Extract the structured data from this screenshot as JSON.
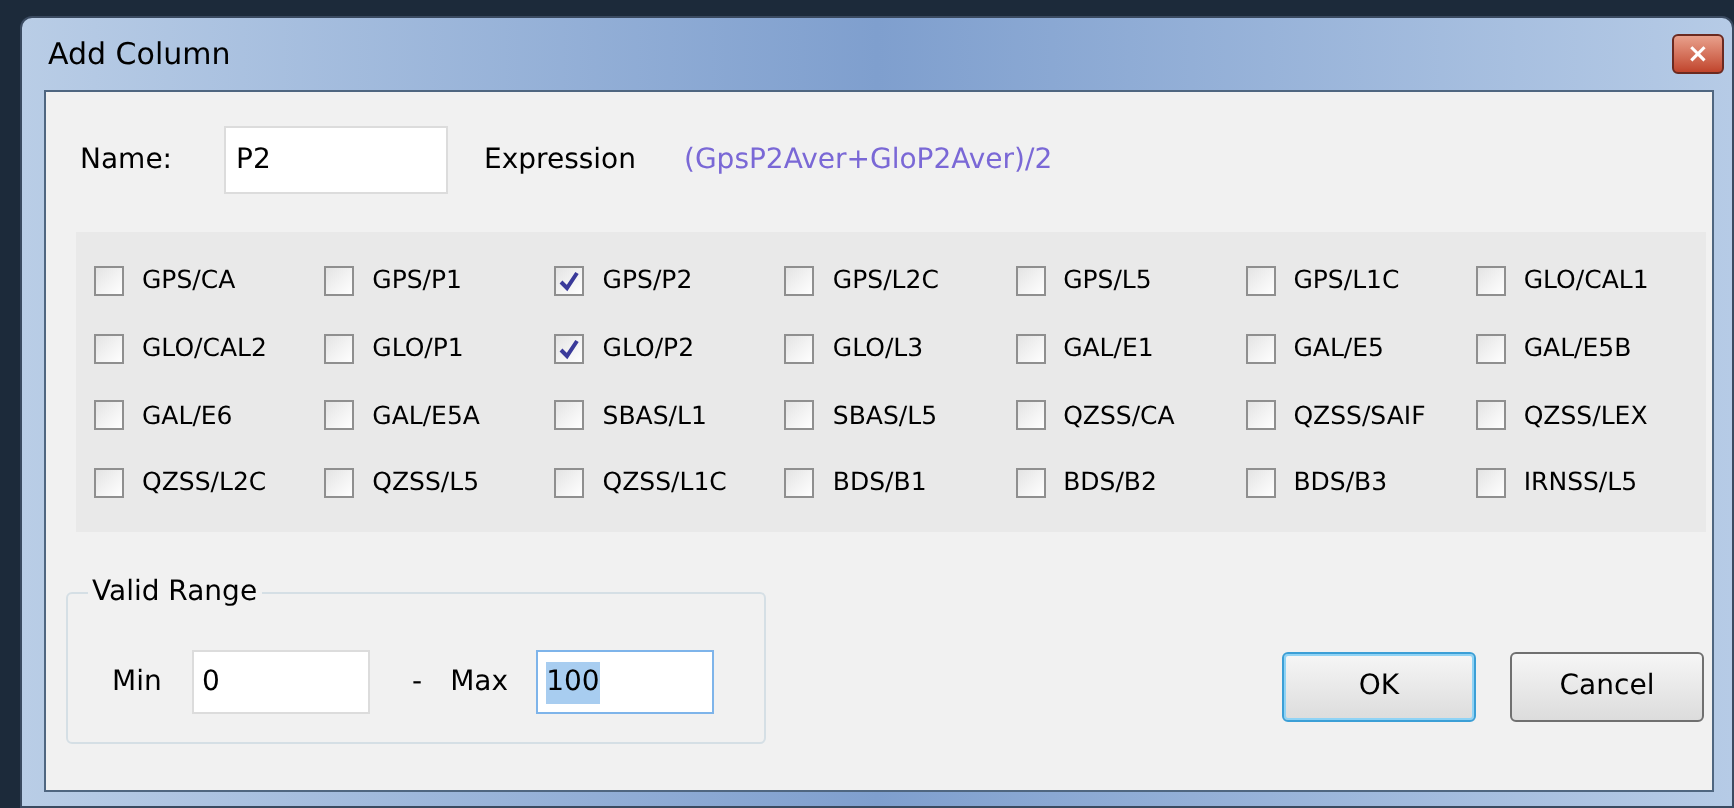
{
  "window": {
    "title": "Add Column",
    "close": "×"
  },
  "name_field": {
    "label": "Name:",
    "value": "P2"
  },
  "expression": {
    "label": "Expression",
    "value": "(GpsP2Aver+GloP2Aver)/2"
  },
  "signals": [
    {
      "label": "GPS/CA",
      "checked": false
    },
    {
      "label": "GPS/P1",
      "checked": false
    },
    {
      "label": "GPS/P2",
      "checked": true
    },
    {
      "label": "GPS/L2C",
      "checked": false
    },
    {
      "label": "GPS/L5",
      "checked": false
    },
    {
      "label": "GPS/L1C",
      "checked": false
    },
    {
      "label": "GLO/CAL1",
      "checked": false
    },
    {
      "label": "GLO/CAL2",
      "checked": false
    },
    {
      "label": "GLO/P1",
      "checked": false
    },
    {
      "label": "GLO/P2",
      "checked": true
    },
    {
      "label": "GLO/L3",
      "checked": false
    },
    {
      "label": "GAL/E1",
      "checked": false
    },
    {
      "label": "GAL/E5",
      "checked": false
    },
    {
      "label": "GAL/E5B",
      "checked": false
    },
    {
      "label": "GAL/E6",
      "checked": false
    },
    {
      "label": "GAL/E5A",
      "checked": false
    },
    {
      "label": "SBAS/L1",
      "checked": false
    },
    {
      "label": "SBAS/L5",
      "checked": false
    },
    {
      "label": "QZSS/CA",
      "checked": false
    },
    {
      "label": "QZSS/SAIF",
      "checked": false
    },
    {
      "label": "QZSS/LEX",
      "checked": false
    },
    {
      "label": "QZSS/L2C",
      "checked": false
    },
    {
      "label": "QZSS/L5",
      "checked": false
    },
    {
      "label": "QZSS/L1C",
      "checked": false
    },
    {
      "label": "BDS/B1",
      "checked": false
    },
    {
      "label": "BDS/B2",
      "checked": false
    },
    {
      "label": "BDS/B3",
      "checked": false
    },
    {
      "label": "IRNSS/L5",
      "checked": false
    }
  ],
  "valid_range": {
    "title": "Valid Range",
    "min_label": "Min",
    "min_value": "0",
    "separator": "-",
    "max_label": "Max",
    "max_value": "100",
    "max_focused": true
  },
  "buttons": [
    {
      "label": "OK",
      "default": true
    },
    {
      "label": "Cancel",
      "default": false
    }
  ]
}
